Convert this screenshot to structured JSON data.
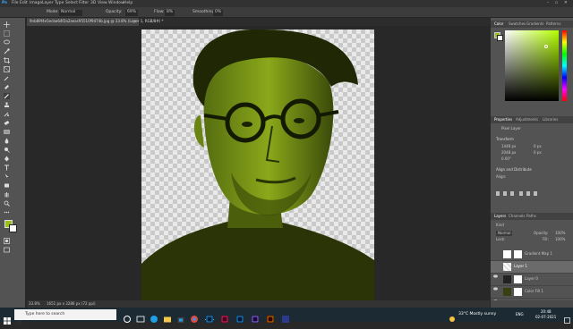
{
  "app": {
    "logo": "Ps",
    "menu": [
      "File",
      "Edit",
      "Image",
      "Layer",
      "Type",
      "Select",
      "Filter",
      "3D",
      "View",
      "Window",
      "Help"
    ]
  },
  "options_bar": {
    "mode_label": "Mode:",
    "mode_value": "Normal",
    "opacity_label": "Opacity:",
    "opacity_value": "69%",
    "flow_label": "Flow:",
    "flow_value": "8%",
    "smoothing_label": "Smoothing:",
    "smoothing_value": "0%"
  },
  "document": {
    "tab_title": "9nb89f4e5ecba64f2a2aeac95510f9474b.jpg @ 33.8% (Layer 1, RGB/8#) *",
    "zoom": "33.8%",
    "doc_info": "1651 px x 3286 px (72 ppi)"
  },
  "color_panel": {
    "tabs": [
      "Color",
      "Swatches",
      "Gradients",
      "Patterns"
    ],
    "active_tab": "Color",
    "fg": "#9bbf1e",
    "hue": "#b4ff00"
  },
  "properties_panel": {
    "tabs": [
      "Properties",
      "Adjustments",
      "Libraries"
    ],
    "active_tab": "Properties",
    "kind": "Pixel Layer",
    "transform_label": "Transform",
    "w_value": "1448 px",
    "h_value": "2048 px",
    "x_value": "0 px",
    "y_value": "0 px",
    "angle_value": "0.00°",
    "align_label": "Align and Distribute",
    "align_sub": "Align:"
  },
  "layers_panel": {
    "tabs": [
      "Layers",
      "Channels",
      "Paths"
    ],
    "active_tab": "Layers",
    "kind_label": "Kind",
    "blend_mode": "Normal",
    "opacity_label": "Opacity:",
    "opacity_value": "100%",
    "lock_label": "Lock:",
    "fill_label": "Fill:",
    "fill_value": "100%",
    "layers": [
      {
        "name": "Gradient Map 1",
        "selected": false
      },
      {
        "name": "Layer 1",
        "selected": true
      },
      {
        "name": "Layer 0",
        "selected": false
      },
      {
        "name": "Color Fill 1",
        "selected": false
      }
    ]
  },
  "taskbar": {
    "search_placeholder": "Type here to search",
    "weather": "33°C  Mostly sunny",
    "lang": "ENG",
    "time": "20:48",
    "date": "02-07-2021"
  },
  "colors": {
    "accent_yellow": "#9bbf1e",
    "bg_dark": "#282828",
    "panel": "#535353"
  }
}
